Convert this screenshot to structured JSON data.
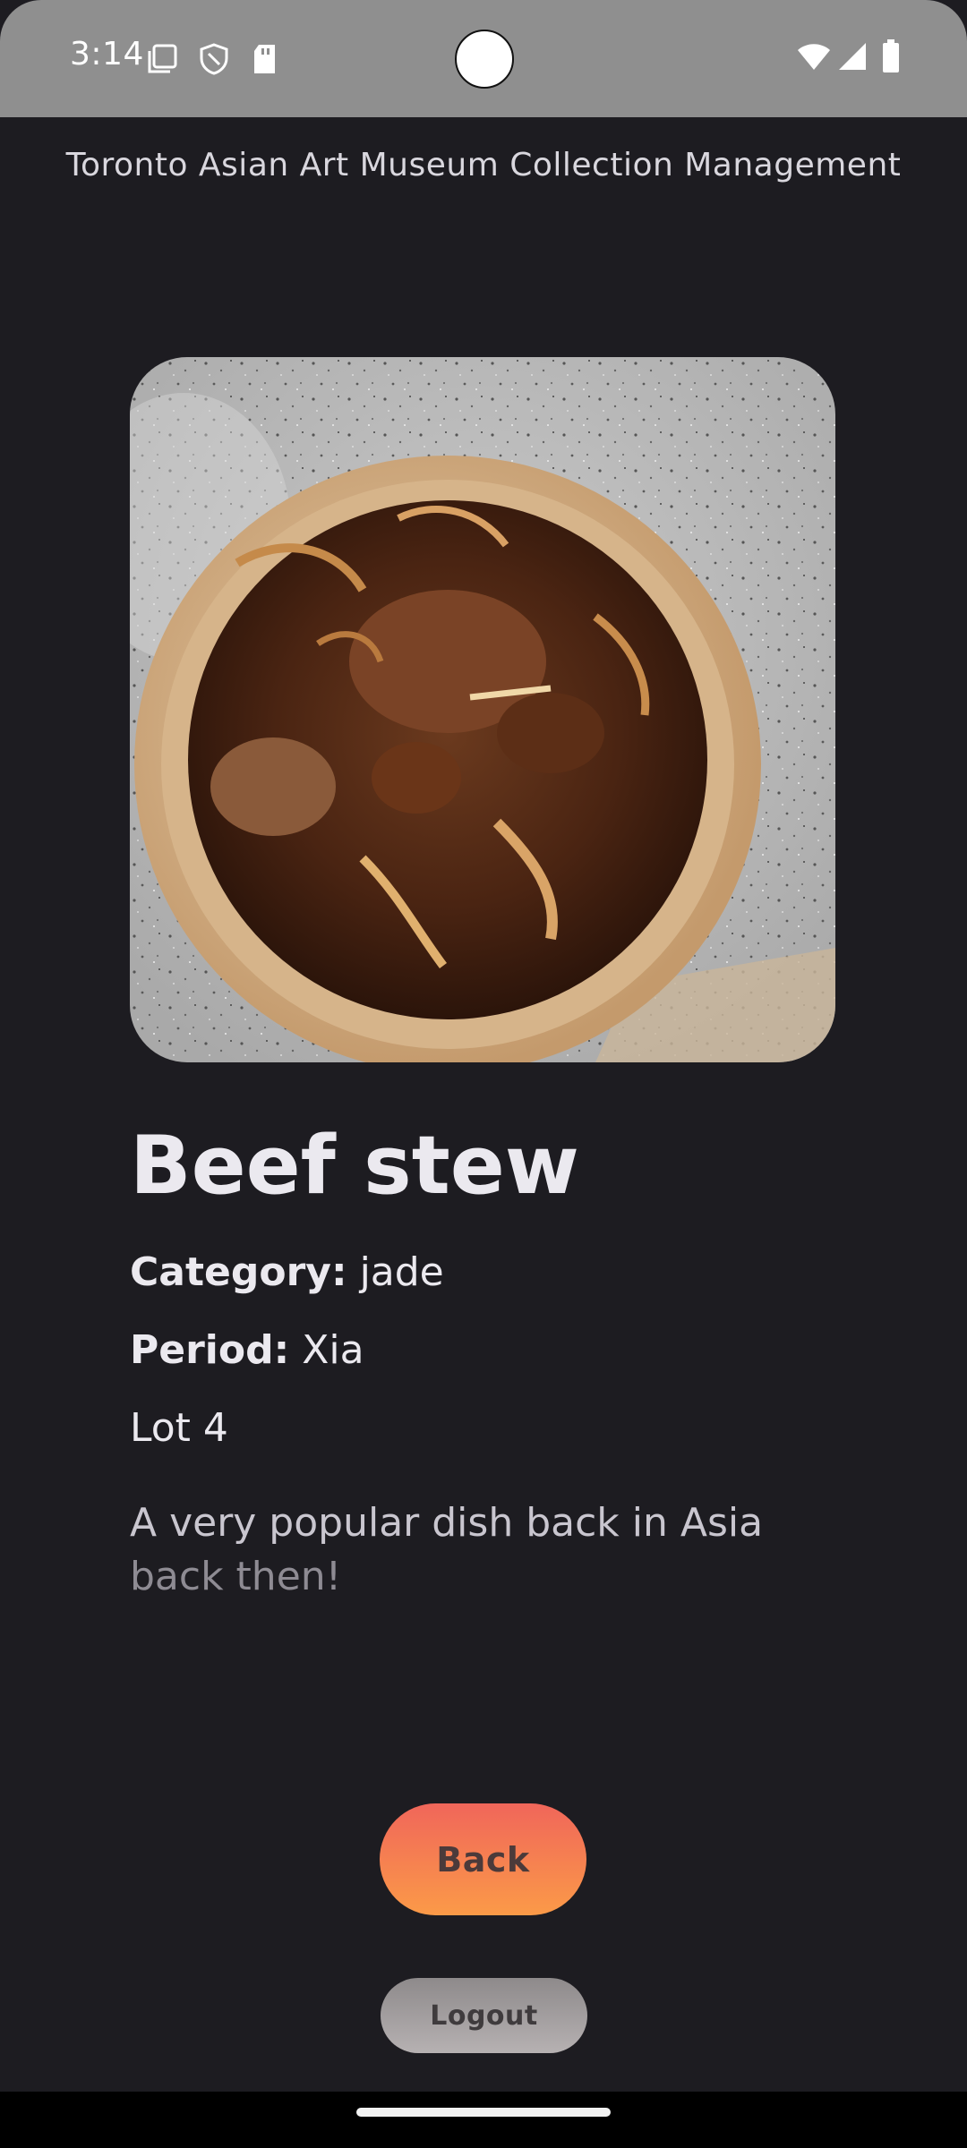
{
  "status_bar": {
    "time": "3:14",
    "icons": [
      "screenshot-icon",
      "shield-icon",
      "sd-card-icon",
      "wifi-icon",
      "signal-icon",
      "battery-icon"
    ]
  },
  "header": {
    "title": "Toronto Asian Art Museum Collection Management"
  },
  "item": {
    "image_icon": "food-photo",
    "name": "Beef stew",
    "category_label": "Category:",
    "category_value": "jade",
    "period_label": "Period:",
    "period_value": "Xia",
    "lot": "Lot 4",
    "description_main": "A very popular dish back in Asia",
    "description_faded": "back then!"
  },
  "buttons": {
    "back_label": "Back",
    "logout_label": "Logout"
  },
  "colors": {
    "background": "#1d1c21",
    "status_bar": "#8f8f8f",
    "back_gradient_top": "#f0665a",
    "back_gradient_bottom": "#fb9a48",
    "logout_gradient_top": "#8e8a8b",
    "logout_gradient_bottom": "#b6b1b2"
  }
}
